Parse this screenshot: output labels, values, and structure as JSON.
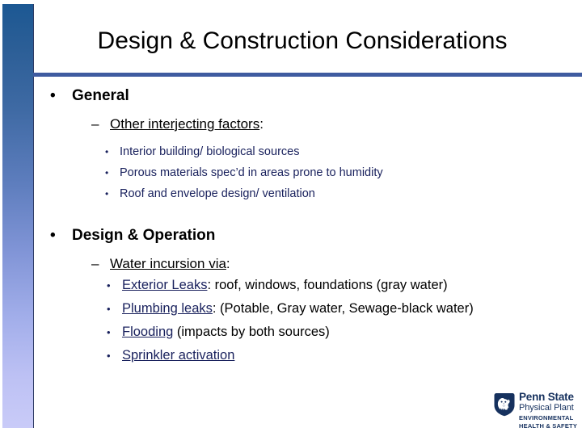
{
  "slide": {
    "title": "Design & Construction Considerations",
    "accent_color": "#3f5ba0",
    "navy_color": "#18205c",
    "bar_top_color": "#1c5893",
    "bar_bottom_color": "#c9cbf8"
  },
  "bullets": {
    "marker_disc": "•",
    "marker_dash": "–"
  },
  "sections": [
    {
      "heading": "General",
      "sub_heading": "Other interjecting factors",
      "sub_heading_suffix": ":",
      "items": [
        "Interior building/ biological sources",
        "Porous materials spec’d in areas prone to humidity",
        "Roof and envelope design/ ventilation"
      ]
    },
    {
      "heading": "Design & Operation",
      "sub_heading": "Water incursion via",
      "sub_heading_suffix": ":",
      "items": [
        {
          "lead": "Exterior Leaks",
          "rest": ": roof, windows, foundations (gray water)"
        },
        {
          "lead": "Plumbing leaks",
          "rest": ":  (Potable, Gray water, Sewage-black water)"
        },
        {
          "lead": "Flooding",
          "rest": " (impacts by both sources)"
        },
        {
          "lead": "Sprinkler activation",
          "rest": ""
        }
      ]
    }
  ],
  "logo": {
    "name": "Penn State",
    "unit": "Physical Plant",
    "dept_line1": "ENVIRONMENTAL",
    "dept_line2": "HEALTH & SAFETY",
    "shield_color": "#16315e"
  }
}
